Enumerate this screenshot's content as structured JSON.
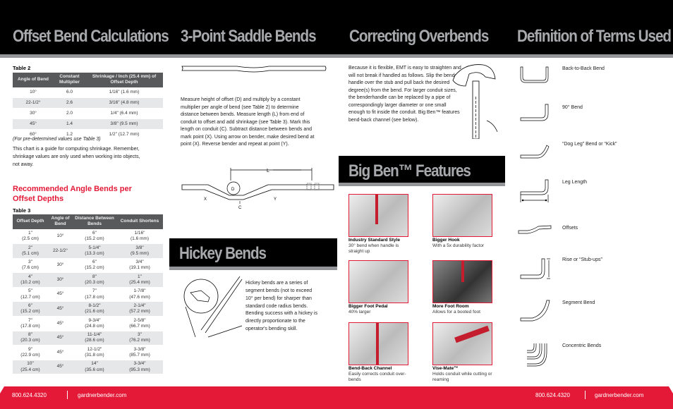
{
  "titles": {
    "offset": "Offset Bend Calculations",
    "saddle": "3-Point Saddle Bends",
    "overbends": "Correcting Overbends",
    "terms": "Definition of Terms Used",
    "hickey": "Hickey Bends",
    "bigben": "Big Ben™ Features"
  },
  "table2": {
    "label": "Table 2",
    "headers": [
      "Angle of Bend",
      "Constant Multiplier",
      "Shrinkage / Inch (25.4 mm) of Offset Depth"
    ],
    "rows": [
      [
        "10°",
        "6.0",
        "1/16\" (1.6 mm)"
      ],
      [
        "22-1/2°",
        "2.6",
        "3/16\" (4.8 mm)"
      ],
      [
        "30°",
        "2.0",
        "1/4\" (6.4 mm)"
      ],
      [
        "45°",
        "1.4",
        "3/8\" (9.5 mm)"
      ],
      [
        "60°",
        "1.2",
        "1/2\" (12.7 mm)"
      ]
    ]
  },
  "offset_notes": {
    "predetermined": "(For pre-determined values use Table 3)",
    "guide": "This chart is a guide for computing shrinkage. Remember, shrinkage values are only used when working into objects, not away."
  },
  "recommended_heading": "Recommended Angle Bends per Offset Depths",
  "table3": {
    "label": "Table 3",
    "headers": [
      "Offset Depth",
      "Angle of Bend",
      "Distance Between Bends",
      "Conduit Shortens"
    ],
    "rows": [
      [
        "1\"",
        "(2.5 cm)",
        "10°",
        "6\"",
        "(15.2 cm)",
        "1/16\"",
        "(1.6 mm)"
      ],
      [
        "2\"",
        "(5.1 cm)",
        "22-1/2°",
        "5-1/4\"",
        "(13.3 cm)",
        "3/8\"",
        "(9.5 mm)"
      ],
      [
        "3\"",
        "(7.6 cm)",
        "30°",
        "6\"",
        "(15.2 cm)",
        "3/4\"",
        "(19.1 mm)"
      ],
      [
        "4\"",
        "(10.2 cm)",
        "30°",
        "8\"",
        "(20.3 cm)",
        "1\"",
        "(25.4 mm)"
      ],
      [
        "5\"",
        "(12.7 cm)",
        "45°",
        "7\"",
        "(17.8 cm)",
        "1-7/8\"",
        "(47.6 mm)"
      ],
      [
        "6\"",
        "(15.2 cm)",
        "45°",
        "8-1/2\"",
        "(21.6 cm)",
        "2-1/4\"",
        "(57.2 mm)"
      ],
      [
        "7\"",
        "(17.8 cm)",
        "45°",
        "9-3/4\"",
        "(24.8 cm)",
        "2-5/8\"",
        "(66.7 mm)"
      ],
      [
        "8\"",
        "(20.3 cm)",
        "45°",
        "11-1/4\"",
        "(28.6 cm)",
        "3\"",
        "(76.2 mm)"
      ],
      [
        "9\"",
        "(22.9 cm)",
        "45°",
        "12-1/2\"",
        "(31.8 cm)",
        "3-3/8\"",
        "(85.7 mm)"
      ],
      [
        "10\"",
        "(25.4 cm)",
        "45°",
        "14\"",
        "(35.6 cm)",
        "3-3/4\"",
        "(95.3 mm)"
      ]
    ]
  },
  "saddle_text": "Measure height of offset (D) and multiply by a constant multiplier per angle of bend (see Table 2) to determine distance between bends. Measure length (L) from end of conduit to offset and add shrinkage (see Table 3). Mark this length on conduit (C). Subtract distance between bends and mark point (X). Using arrow on bender, make desired bend at point (X). Reverse bender and repeat at point (Y).",
  "saddle_diagram_labels": {
    "L": "L",
    "D": "D",
    "X": "X",
    "Y": "Y",
    "C": "C"
  },
  "hickey_text": "Hickey bends are a series of segment bends (not to exceed 10° per bend) for sharper than standard code radius bends. Bending success with a hickey is directly proportionate to the operator's bending skill.",
  "overbends_text": "Because it is flexible, EMT is easy to straighten and will not break if handled as follows. Slip the bender handle over the stub and pull back the desired degree(s) from the bend. For larger conduit sizes, the benderhandle can be replaced by a pipe of correspondingly larger diameter or one small enough to fit inside the conduit. Big Ben™ features bend-back channel (see below).",
  "features": [
    {
      "title": "Industry Standard Style",
      "desc": "30° bend when handle is straight up"
    },
    {
      "title": "Bigger Hook",
      "desc": "With a 5x durability factor"
    },
    {
      "title": "Bigger Foot Pedal",
      "desc": "40% larger"
    },
    {
      "title": "More Foot Room",
      "desc": "Allows for a booted foot"
    },
    {
      "title": "Bend-Back Channel",
      "desc": "Easily corrects conduit over-bends"
    },
    {
      "title": "Vise-Mate™",
      "desc": "Holds conduit while cutting or reaming"
    }
  ],
  "terms": [
    "Back-to-Back Bend",
    "90° Bend",
    "“Dog Leg” Bend or “Kick”",
    "Leg Length",
    "Offsets",
    "Rise or “Stub-ups”",
    "Segment Bend",
    "Concentric Bends"
  ],
  "footer": {
    "phone": "800.624.4320",
    "website": "gardnerbender.com"
  },
  "colors": {
    "accent": "#e31937",
    "header_bg": "#000000",
    "title_gray": "#a7a9ac",
    "stripe": "#939598"
  }
}
